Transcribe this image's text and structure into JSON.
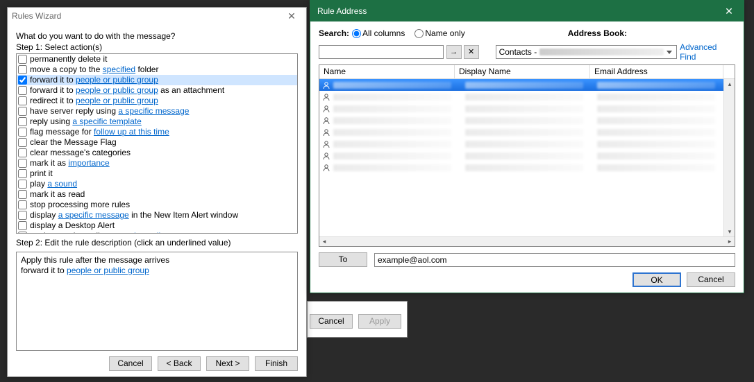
{
  "rules_wizard": {
    "title": "Rules Wizard",
    "question": "What do you want to do with the message?",
    "step1_label": "Step 1: Select action(s)",
    "step2_label": "Step 2: Edit the rule description (click an underlined value)",
    "actions": [
      {
        "prefix": "permanently delete it",
        "link": "",
        "suffix": "",
        "checked": false
      },
      {
        "prefix": "move a copy to the ",
        "link": "specified",
        "suffix": " folder",
        "checked": false
      },
      {
        "prefix": "forward it to ",
        "link": "people or public group",
        "suffix": "",
        "checked": true,
        "selected": true
      },
      {
        "prefix": "forward it to ",
        "link": "people or public group",
        "suffix": " as an attachment",
        "checked": false
      },
      {
        "prefix": "redirect it to ",
        "link": "people or public group",
        "suffix": "",
        "checked": false
      },
      {
        "prefix": "have server reply using ",
        "link": "a specific message",
        "suffix": "",
        "checked": false
      },
      {
        "prefix": "reply using ",
        "link": "a specific template",
        "suffix": "",
        "checked": false
      },
      {
        "prefix": "flag message for ",
        "link": "follow up at this time",
        "suffix": "",
        "checked": false
      },
      {
        "prefix": "clear the Message Flag",
        "link": "",
        "suffix": "",
        "checked": false
      },
      {
        "prefix": "clear message's categories",
        "link": "",
        "suffix": "",
        "checked": false
      },
      {
        "prefix": "mark it as ",
        "link": "importance",
        "suffix": "",
        "checked": false
      },
      {
        "prefix": "print it",
        "link": "",
        "suffix": "",
        "checked": false
      },
      {
        "prefix": "play ",
        "link": "a sound",
        "suffix": "",
        "checked": false
      },
      {
        "prefix": "mark it as read",
        "link": "",
        "suffix": "",
        "checked": false
      },
      {
        "prefix": "stop processing more rules",
        "link": "",
        "suffix": "",
        "checked": false
      },
      {
        "prefix": "display ",
        "link": "a specific message",
        "suffix": " in the New Item Alert window",
        "checked": false
      },
      {
        "prefix": "display a Desktop Alert",
        "link": "",
        "suffix": "",
        "checked": false
      },
      {
        "prefix": "apply retention policy: ",
        "link": "retention policy",
        "suffix": "",
        "checked": false
      }
    ],
    "desc": {
      "line1": "Apply this rule after the message arrives",
      "line2_prefix": "forward it to ",
      "line2_link": "people or public group"
    },
    "buttons": {
      "cancel": "Cancel",
      "back": "< Back",
      "next": "Next >",
      "finish": "Finish"
    }
  },
  "props": {
    "cancel": "Cancel",
    "apply": "Apply"
  },
  "rule_address": {
    "title": "Rule Address",
    "search_label": "Search:",
    "radio_all": "All columns",
    "radio_name": "Name only",
    "address_book_label": "Address Book:",
    "go_label": "→",
    "x_label": "✕",
    "book_value": "Contacts -",
    "advanced": "Advanced Find",
    "columns": {
      "name": "Name",
      "disp": "Display Name",
      "email": "Email Address"
    },
    "row_count": 8,
    "to_label": "To",
    "to_value": "example@aol.com",
    "ok": "OK",
    "cancel": "Cancel"
  }
}
